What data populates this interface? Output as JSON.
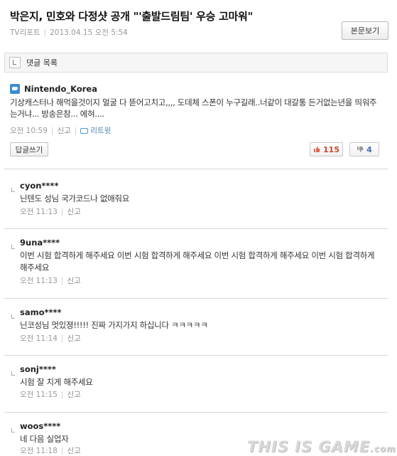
{
  "article": {
    "headline": "박은지, 민호와 다정샷 공개 \"'출발드림팀' 우승 고마워\"",
    "source": "TV리포트",
    "datetime": "2013.04.15 오전 5:54",
    "view_button": "본문보기"
  },
  "comments_bar": {
    "label": "댓글 목록"
  },
  "main_comment": {
    "author": "Nintendo_Korea",
    "text": "기상캐스터나 해먹을것이지 얼굴 다 뜯어고치고,,,, 도데체 스폰이 누구길래..너같이 대갈통 든거없는년을 띄워주는거냐... 방송은참... 에혀....",
    "time": "오전 10:59",
    "report_label": "신고",
    "retweet_label": "리트윗",
    "reply_button": "답글쓰기",
    "likes": "115",
    "dislikes": "4"
  },
  "replies": [
    {
      "author": "cyon****",
      "text": "닌텐도 성님 국가코드나 없애줘요",
      "time": "오전 11:13",
      "report": "신고"
    },
    {
      "author": "9una****",
      "text": "이번 시험 합격하게 해주세요 이번 시험 합격하게 해주세요 이번 시험 합격하게 해주세요 이번 시험 합격하게 해주세요",
      "time": "오전 11:13",
      "report": "신고"
    },
    {
      "author": "samo****",
      "text": "닌코성님 멋있졍!!!!! 진짜 가지가지 하십니다 ㅋㅋㅋㅋㅋ",
      "time": "오전 11:14",
      "report": "신고"
    },
    {
      "author": "sonj****",
      "text": "시험 잘 치게 해주세요",
      "time": "오전 11:15",
      "report": "신고"
    },
    {
      "author": "woos****",
      "text": "네 다음 실업자",
      "time": "오전 11:18",
      "report": "신고"
    }
  ],
  "watermark": {
    "text": "THIS IS GAME",
    "suffix": ".com"
  },
  "colors": {
    "like": "#d2452c",
    "dislike": "#3f6fb0",
    "twitter": "#3d8cd6"
  },
  "icons": [
    "twitter-icon",
    "retweet-icon",
    "thumbs-up-icon",
    "thumbs-down-icon",
    "reply-elbow-icon",
    "comment-list-icon"
  ]
}
